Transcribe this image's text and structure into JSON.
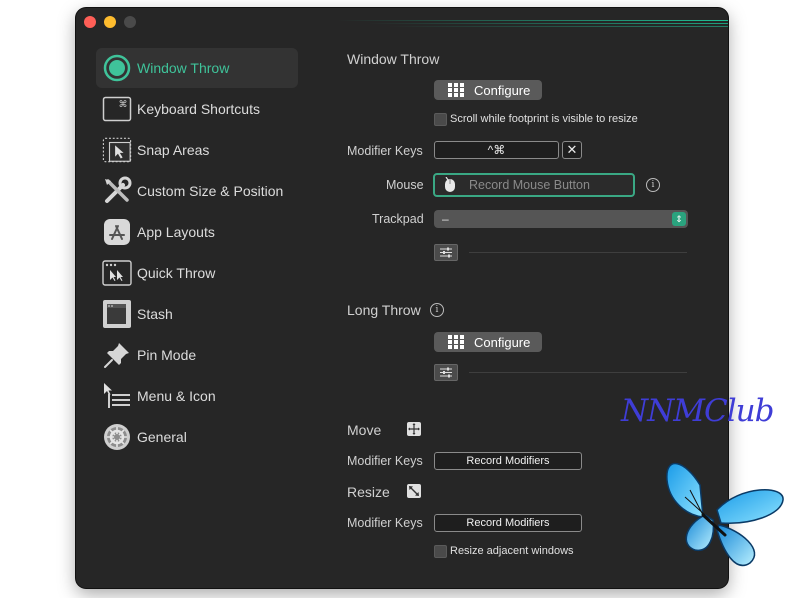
{
  "sidebar": {
    "items": [
      {
        "label": "Window Throw",
        "icon": "window-throw-icon",
        "active": true
      },
      {
        "label": "Keyboard Shortcuts",
        "icon": "keyboard-shortcut-icon"
      },
      {
        "label": "Snap Areas",
        "icon": "snap-areas-icon"
      },
      {
        "label": "Custom Size & Position",
        "icon": "tools-icon"
      },
      {
        "label": "App Layouts",
        "icon": "app-store-icon"
      },
      {
        "label": "Quick Throw",
        "icon": "quick-throw-icon"
      },
      {
        "label": "Stash",
        "icon": "stash-icon"
      },
      {
        "label": "Pin Mode",
        "icon": "pin-icon"
      },
      {
        "label": "Menu & Icon",
        "icon": "menu-icon"
      },
      {
        "label": "General",
        "icon": "gear-icon"
      }
    ]
  },
  "window_throw": {
    "title": "Window Throw",
    "configure_label": "Configure",
    "scroll_checkbox_label": "Scroll while footprint is visible to resize",
    "modifier_keys_label": "Modifier Keys",
    "modifier_keys_value": "^⌘",
    "clear_symbol": "✕",
    "mouse_label": "Mouse",
    "mouse_placeholder": "Record Mouse Button",
    "info_symbol": "i",
    "trackpad_label": "Trackpad",
    "trackpad_value": "–"
  },
  "long_throw": {
    "title": "Long Throw",
    "info_symbol": "i",
    "configure_label": "Configure"
  },
  "move": {
    "title": "Move",
    "modifier_keys_label": "Modifier Keys",
    "record_label": "Record Modifiers"
  },
  "resize": {
    "title": "Resize",
    "modifier_keys_label": "Modifier Keys",
    "record_label": "Record Modifiers",
    "adjacent_checkbox_label": "Resize adjacent windows"
  },
  "watermark": {
    "text": "NNMClub"
  },
  "colors": {
    "accent": "#3fc39a",
    "window_bg": "#262626",
    "watermark": "#3f3dd6"
  }
}
